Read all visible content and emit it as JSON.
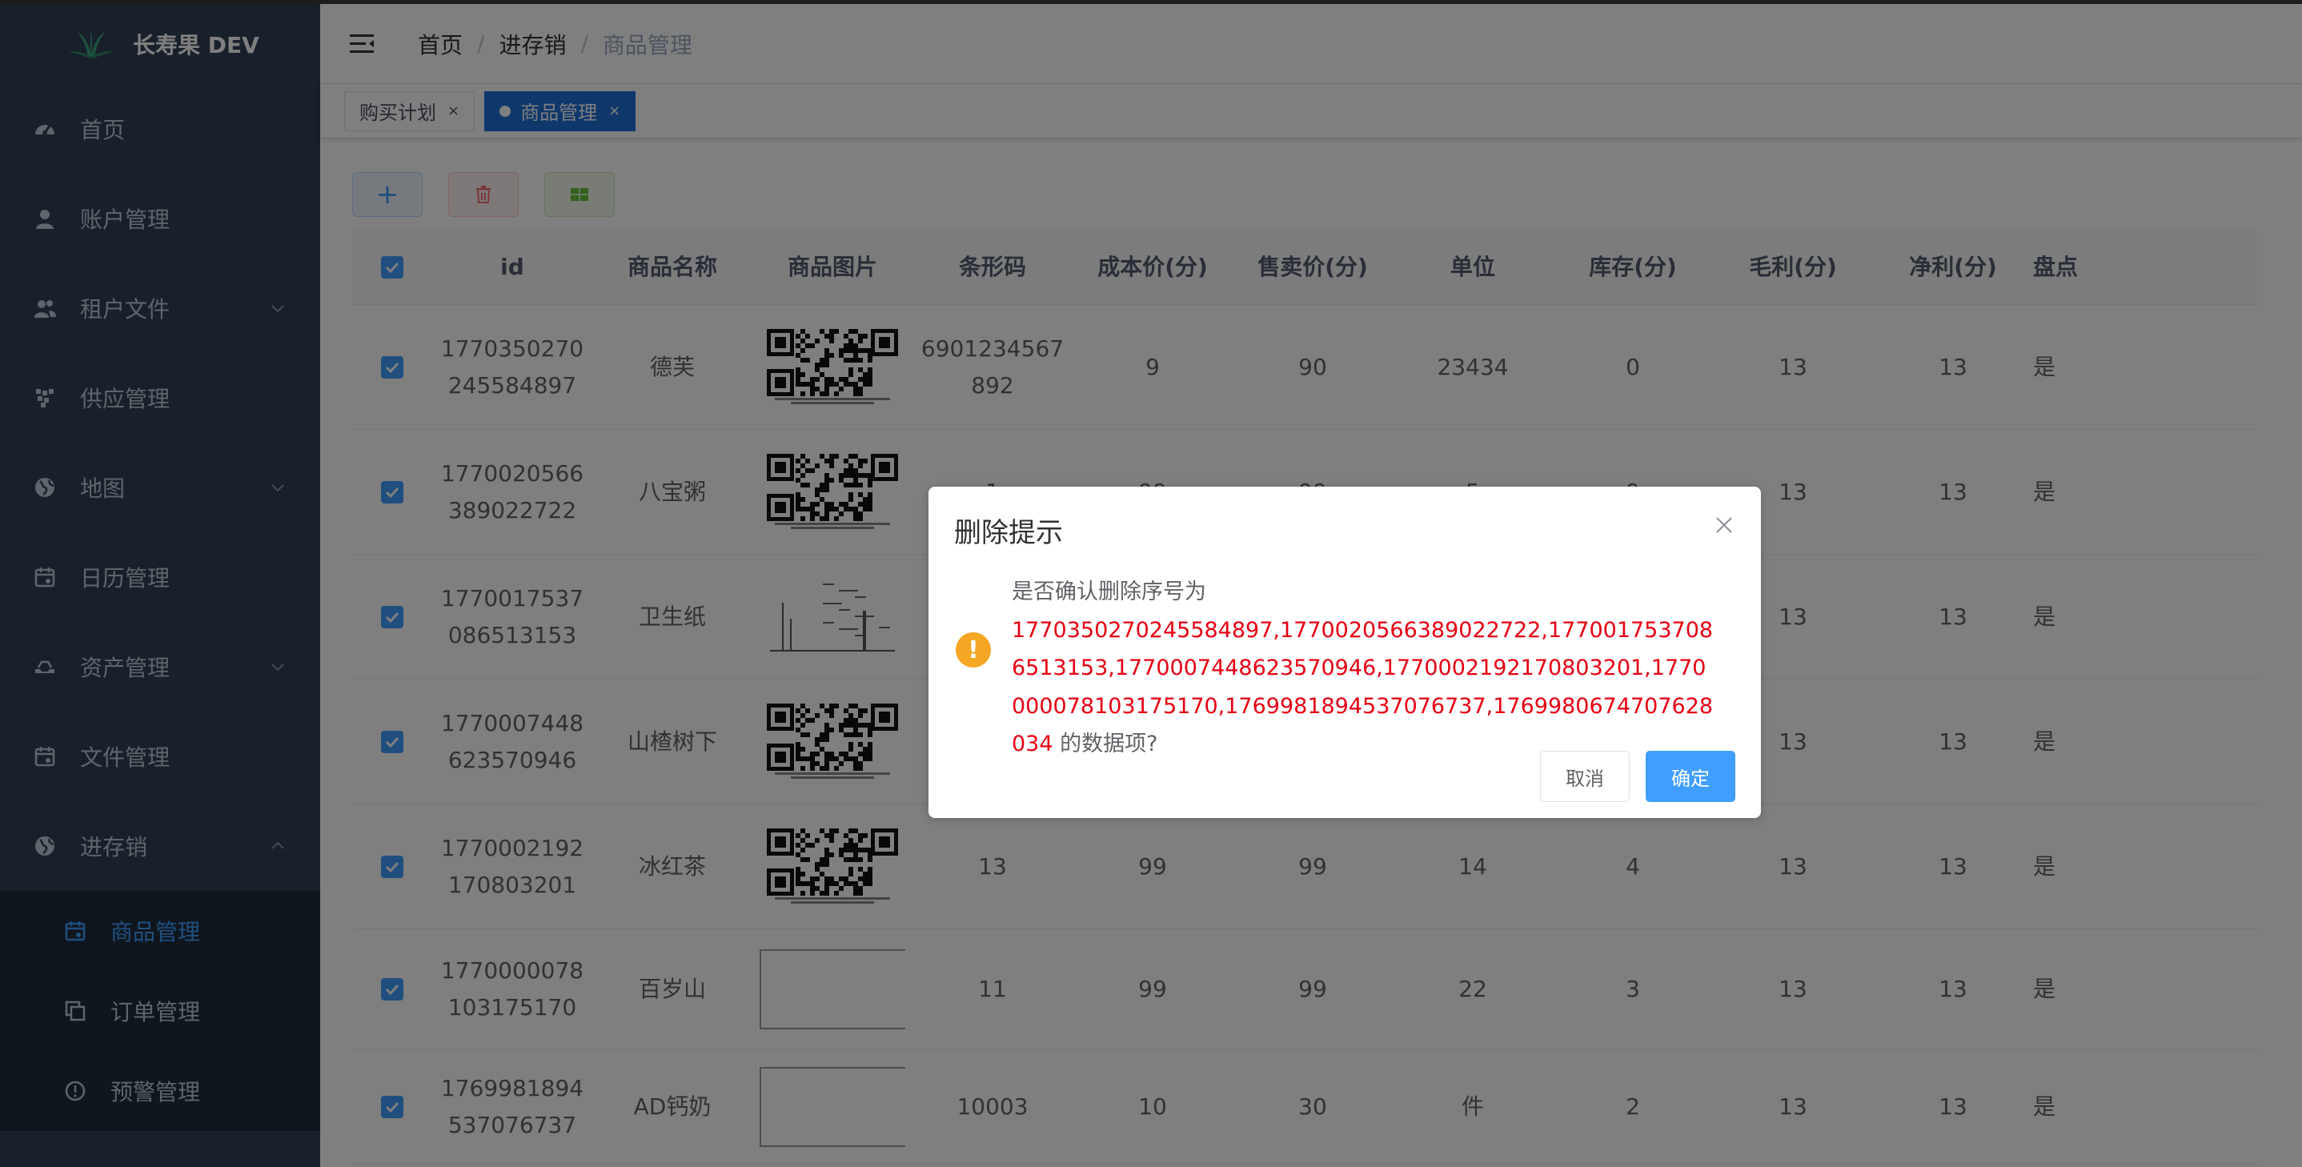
{
  "brand": {
    "title": "长寿果 DEV"
  },
  "sidebar": {
    "items": [
      {
        "label": "首页",
        "icon": "dashboard-icon"
      },
      {
        "label": "账户管理",
        "icon": "user-icon"
      },
      {
        "label": "租户文件",
        "icon": "peoples-icon",
        "expandable": true
      },
      {
        "label": "供应管理",
        "icon": "component-icon"
      },
      {
        "label": "地图",
        "icon": "globe-icon",
        "expandable": true
      },
      {
        "label": "日历管理",
        "icon": "calendar-icon"
      },
      {
        "label": "资产管理",
        "icon": "tray-icon",
        "expandable": true
      },
      {
        "label": "文件管理",
        "icon": "calendar-icon"
      },
      {
        "label": "进存销",
        "icon": "globe-icon",
        "expandable": true,
        "expanded": true
      }
    ],
    "submenu": [
      {
        "label": "商品管理",
        "active": true,
        "icon": "calendar-icon"
      },
      {
        "label": "订单管理",
        "icon": "copy-icon"
      },
      {
        "label": "预警管理",
        "icon": "alert-circle-icon"
      }
    ]
  },
  "breadcrumb": [
    "首页",
    "进存销",
    "商品管理"
  ],
  "tags": [
    {
      "label": "购买计划",
      "active": false
    },
    {
      "label": "商品管理",
      "active": true
    }
  ],
  "toolbar": {
    "add_label": "+"
  },
  "table": {
    "headers": [
      "id",
      "商品名称",
      "商品图片",
      "条形码",
      "成本价(分)",
      "售卖价(分)",
      "单位",
      "库存(分)",
      "毛利(分)",
      "净利(分)",
      "盘点"
    ],
    "rows": [
      {
        "id": [
          "1770350270",
          "245584897"
        ],
        "name": "德芙",
        "img": "qr",
        "barcode": [
          "6901234567",
          "892"
        ],
        "cost": "9",
        "sale": "90",
        "unit": "23434",
        "stock": "0",
        "gross": "13",
        "net": "13",
        "check": "是"
      },
      {
        "id": [
          "1770020566",
          "389022722"
        ],
        "name": "八宝粥",
        "img": "qr",
        "barcode": [
          "1"
        ],
        "cost": "99",
        "sale": "99",
        "unit": "5",
        "stock": "9",
        "gross": "13",
        "net": "13",
        "check": "是"
      },
      {
        "id": [
          "1770017537",
          "086513153"
        ],
        "name": "卫生纸",
        "img": "sketch",
        "barcode": [
          ""
        ],
        "cost": "",
        "sale": "",
        "unit": "",
        "stock": "",
        "gross": "13",
        "net": "13",
        "check": "是"
      },
      {
        "id": [
          "1770007448",
          "623570946"
        ],
        "name": "山楂树下",
        "img": "qr",
        "barcode": [
          ""
        ],
        "cost": "",
        "sale": "",
        "unit": "",
        "stock": "",
        "gross": "13",
        "net": "13",
        "check": "是"
      },
      {
        "id": [
          "1770002192",
          "170803201"
        ],
        "name": "冰红茶",
        "img": "qr",
        "barcode": [
          "13"
        ],
        "cost": "99",
        "sale": "99",
        "unit": "14",
        "stock": "4",
        "gross": "13",
        "net": "13",
        "check": "是"
      },
      {
        "id": [
          "1770000078",
          "103175170"
        ],
        "name": "百岁山",
        "img": "blank",
        "barcode": [
          "11"
        ],
        "cost": "99",
        "sale": "99",
        "unit": "22",
        "stock": "3",
        "gross": "13",
        "net": "13",
        "check": "是"
      },
      {
        "id": [
          "1769981894",
          "537076737"
        ],
        "name": "AD钙奶",
        "img": "blank",
        "barcode": [
          "10003"
        ],
        "cost": "10",
        "sale": "30",
        "unit": "件",
        "stock": "2",
        "gross": "13",
        "net": "13",
        "check": "是"
      }
    ]
  },
  "dialog": {
    "title": "删除提示",
    "message_prefix": "是否确认删除序号为",
    "ids": "1770350270245584897,1770020566389022722,1770017537086513153,1770007448623570946,1770002192170803201,1770000078103175170,1769981894537076737,1769980674707628034",
    "message_suffix": " 的数据项?",
    "cancel_label": "取消",
    "confirm_label": "确定"
  },
  "colors": {
    "sidebar_bg": "#304156",
    "submenu_bg": "#1f2d3d",
    "primary": "#409eff",
    "danger_text": "#e60012",
    "warning": "#f5a623"
  }
}
